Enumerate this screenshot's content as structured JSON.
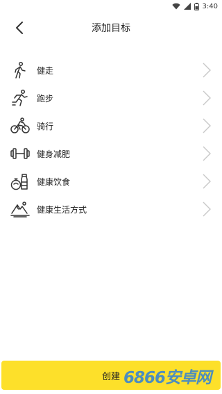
{
  "status_bar": {
    "time": "3:40"
  },
  "header": {
    "title": "添加目标"
  },
  "items": [
    {
      "label": "健走",
      "icon": "walking-icon"
    },
    {
      "label": "跑步",
      "icon": "running-icon"
    },
    {
      "label": "骑行",
      "icon": "cycling-icon"
    },
    {
      "label": "健身减肥",
      "icon": "dumbbell-icon"
    },
    {
      "label": "健康饮食",
      "icon": "healthy-food-icon"
    },
    {
      "label": "健康生活方式",
      "icon": "mountain-icon"
    }
  ],
  "create_button": {
    "label": "创建"
  },
  "watermark": {
    "text": "6866安卓网"
  },
  "colors": {
    "accent": "#fde02a",
    "watermark": "#2f7fd8"
  }
}
